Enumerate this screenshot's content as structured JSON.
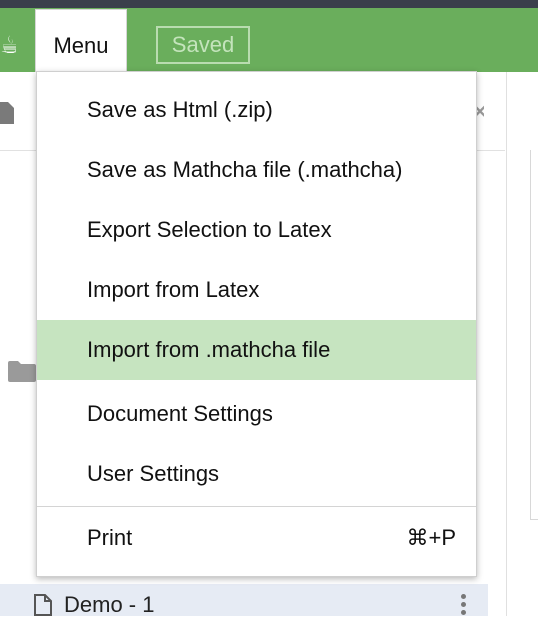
{
  "toolbar": {
    "menu_label": "Menu",
    "saved_label": "Saved",
    "accent_color": "#6aae5c"
  },
  "menu": {
    "items": [
      {
        "label": "Save as Html (.zip)"
      },
      {
        "label": "Save as Mathcha file (.mathcha)"
      },
      {
        "label": "Export Selection to Latex"
      },
      {
        "label": "Import from Latex"
      },
      {
        "label": "Import from .mathcha file",
        "highlighted": true
      },
      {
        "label": "Document Settings"
      },
      {
        "label": "User Settings"
      },
      {
        "label": "Print",
        "shortcut": "⌘+P"
      }
    ],
    "highlight_color": "#c6e4c0"
  },
  "sidebar": {
    "file_item": {
      "label": "Demo - 1",
      "selected_color": "#e6ebf4"
    }
  },
  "icons": [
    "logo-icon",
    "document-icon",
    "close-icon",
    "folder-icon",
    "file-icon",
    "kebab-menu-icon"
  ]
}
